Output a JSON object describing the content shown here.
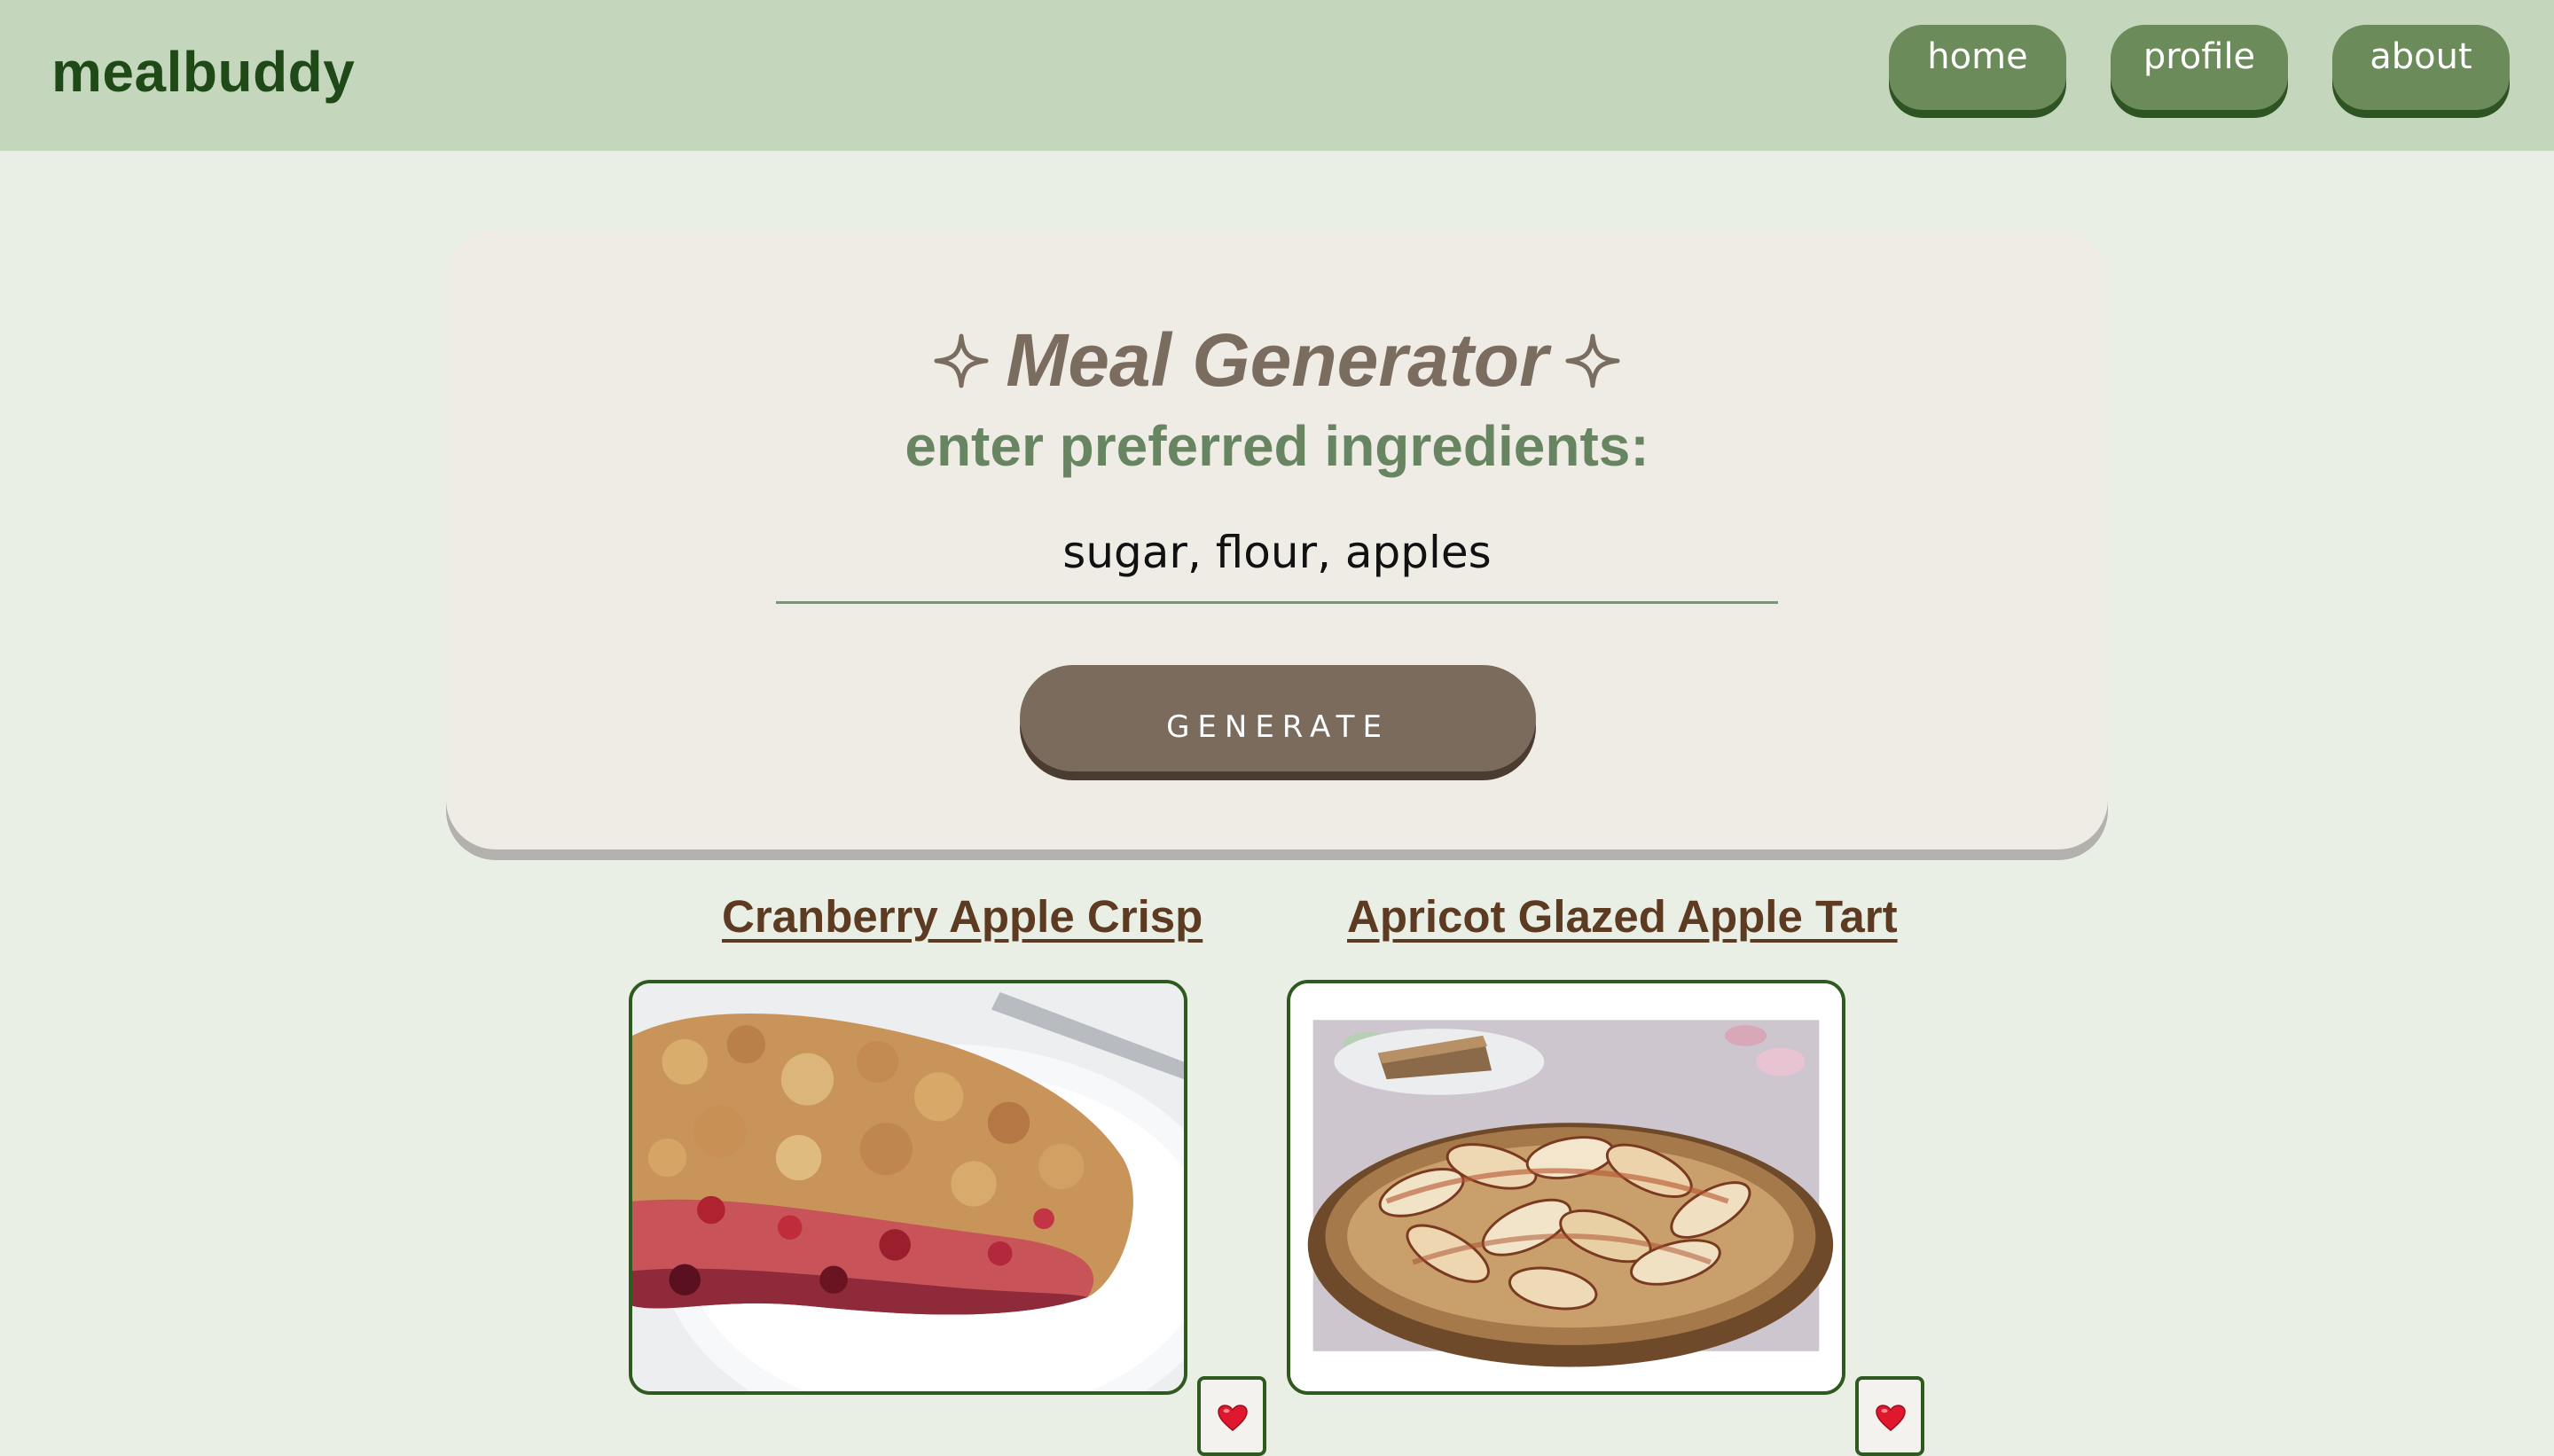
{
  "header": {
    "brand": "mealbuddy",
    "nav": {
      "home": "home",
      "profile": "profile",
      "about": "about"
    }
  },
  "generator": {
    "title": "Meal Generator",
    "subtitle": "enter preferred ingredients:",
    "input_value": "sugar, flour, apples",
    "button_label": "GENERATE"
  },
  "results": [
    {
      "title": "Cranberry Apple Crisp",
      "favorite_icon": "heart-icon"
    },
    {
      "title": "Apricot Glazed Apple Tart",
      "favorite_icon": "heart-icon"
    }
  ],
  "colors": {
    "page_bg": "#e9efe4",
    "header_bg": "#c4d7bd",
    "brand": "#1f4a17",
    "nav_button": "#6b8c5a",
    "card_bg": "#efece6",
    "title": "#7a6c5f",
    "subtitle": "#688561",
    "generate_button": "#7a6b5d",
    "recipe_link": "#5c3b22",
    "heart": "#e0182d"
  },
  "icons": {
    "title_left": "sparkle-icon",
    "title_right": "sparkle-icon"
  }
}
